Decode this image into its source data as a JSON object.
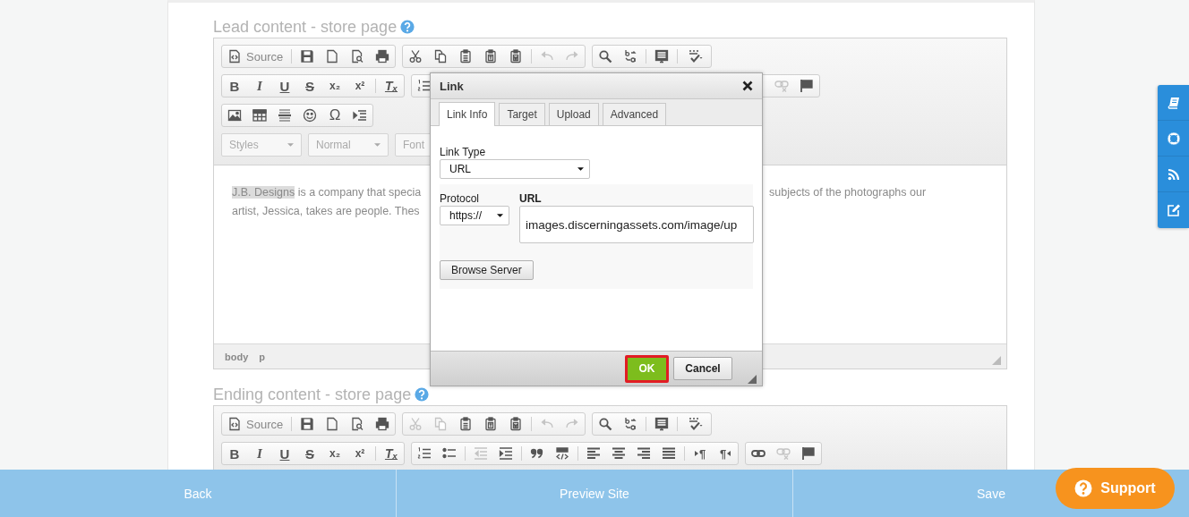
{
  "sections": [
    {
      "title": "Lead content - store page",
      "toolbar": [
        [
          [
            [
              {
                "kind": "source",
                "label": "Source",
                "disabled": false
              }
            ],
            [
              {
                "kind": "save",
                "disabled": false
              },
              {
                "kind": "newpage",
                "disabled": false
              },
              {
                "kind": "preview",
                "disabled": false
              },
              {
                "kind": "print",
                "disabled": false
              }
            ]
          ],
          [
            [
              {
                "kind": "cut",
                "disabled": false
              },
              {
                "kind": "copy",
                "disabled": false
              },
              {
                "kind": "paste",
                "disabled": false
              },
              {
                "kind": "pastetext",
                "disabled": false
              },
              {
                "kind": "pasteword",
                "disabled": false
              }
            ],
            [
              {
                "kind": "undo",
                "disabled": true
              },
              {
                "kind": "redo",
                "disabled": true
              }
            ]
          ],
          [
            [
              {
                "kind": "find",
                "disabled": false
              },
              {
                "kind": "replace",
                "disabled": false
              }
            ],
            [
              {
                "kind": "selectall",
                "disabled": false
              }
            ],
            [
              {
                "kind": "spellcheck",
                "disabled": false
              }
            ]
          ]
        ],
        [
          [
            [
              {
                "kind": "bold",
                "glyph": "B",
                "disabled": false
              },
              {
                "kind": "italic",
                "glyph": "I",
                "disabled": false
              },
              {
                "kind": "underline",
                "glyph": "U",
                "disabled": false
              },
              {
                "kind": "strike",
                "glyph": "S",
                "disabled": false
              },
              {
                "kind": "subscript",
                "glyph": "x₂",
                "disabled": false
              },
              {
                "kind": "superscript",
                "glyph": "x²",
                "disabled": false
              }
            ],
            [
              {
                "kind": "removeformat",
                "glyph": "Tₓ",
                "disabled": false
              }
            ]
          ],
          [
            [
              {
                "kind": "numlist",
                "disabled": false
              }
            ]
          ],
          [
            [
              {
                "kind": "unlink",
                "disabled": true
              },
              {
                "kind": "anchor",
                "disabled": false
              }
            ]
          ]
        ],
        [
          [
            [
              {
                "kind": "image",
                "disabled": false
              },
              {
                "kind": "table",
                "disabled": false
              },
              {
                "kind": "hr",
                "disabled": false
              },
              {
                "kind": "smiley",
                "disabled": false
              },
              {
                "kind": "specialchar",
                "glyph": "Ω",
                "disabled": false
              },
              {
                "kind": "pagebreak",
                "disabled": false
              }
            ]
          ]
        ],
        [
          [
            [
              {
                "kind": "combo",
                "label": "Styles",
                "disabled": true
              }
            ]
          ],
          [
            [
              {
                "kind": "combo",
                "label": "Normal",
                "disabled": true
              }
            ]
          ],
          [
            [
              {
                "kind": "combo",
                "label": "Font",
                "disabled": true
              }
            ]
          ]
        ]
      ],
      "content": {
        "line_1": [
          {
            "text": "J.B. Designs",
            "selected": true
          },
          {
            "text": " is a company that specia",
            "selected": false
          }
        ],
        "line_1_right": "subjects of the photographs our",
        "line_2": "artist, Jessica, takes are people. Thes"
      },
      "path": [
        "body",
        "p"
      ]
    },
    {
      "title": "Ending content - store page",
      "toolbar": [
        [
          [
            [
              {
                "kind": "source",
                "label": "Source",
                "disabled": false
              }
            ],
            [
              {
                "kind": "save",
                "disabled": false
              },
              {
                "kind": "newpage",
                "disabled": false
              },
              {
                "kind": "preview",
                "disabled": false
              },
              {
                "kind": "print",
                "disabled": false
              }
            ]
          ],
          [
            [
              {
                "kind": "cut",
                "disabled": true
              },
              {
                "kind": "copy",
                "disabled": true
              },
              {
                "kind": "paste",
                "disabled": false
              },
              {
                "kind": "pastetext",
                "disabled": false
              },
              {
                "kind": "pasteword",
                "disabled": false
              }
            ],
            [
              {
                "kind": "undo",
                "disabled": true
              },
              {
                "kind": "redo",
                "disabled": true
              }
            ]
          ],
          [
            [
              {
                "kind": "find",
                "disabled": false
              },
              {
                "kind": "replace",
                "disabled": false
              }
            ],
            [
              {
                "kind": "selectall",
                "disabled": false
              }
            ],
            [
              {
                "kind": "spellcheck",
                "disabled": false
              }
            ]
          ]
        ],
        [
          [
            [
              {
                "kind": "bold",
                "glyph": "B",
                "disabled": false
              },
              {
                "kind": "italic",
                "glyph": "I",
                "disabled": false
              },
              {
                "kind": "underline",
                "glyph": "U",
                "disabled": false
              },
              {
                "kind": "strike",
                "glyph": "S",
                "disabled": false
              },
              {
                "kind": "subscript",
                "glyph": "x₂",
                "disabled": false
              },
              {
                "kind": "superscript",
                "glyph": "x²",
                "disabled": false
              }
            ],
            [
              {
                "kind": "removeformat",
                "glyph": "Tₓ",
                "disabled": false
              }
            ]
          ],
          [
            [
              {
                "kind": "numlist",
                "disabled": false
              },
              {
                "kind": "bullist",
                "disabled": false
              }
            ],
            [
              {
                "kind": "outdent",
                "disabled": true
              },
              {
                "kind": "indent",
                "disabled": false
              }
            ],
            [
              {
                "kind": "blockquote",
                "disabled": false
              },
              {
                "kind": "div",
                "disabled": false
              }
            ],
            [
              {
                "kind": "alignleft",
                "disabled": false
              },
              {
                "kind": "aligncenter",
                "disabled": false
              },
              {
                "kind": "alignright",
                "disabled": false
              },
              {
                "kind": "justify",
                "disabled": false
              }
            ],
            [
              {
                "kind": "ltr",
                "glyph": "¶",
                "disabled": false
              },
              {
                "kind": "rtl",
                "glyph": "¶",
                "disabled": false
              }
            ]
          ],
          [
            [
              {
                "kind": "link",
                "disabled": false
              },
              {
                "kind": "unlink",
                "disabled": true
              },
              {
                "kind": "anchor",
                "disabled": false
              }
            ]
          ]
        ]
      ]
    }
  ],
  "dialog": {
    "title": "Link",
    "tabs": [
      {
        "label": "Link Info",
        "selected": true
      },
      {
        "label": "Target",
        "selected": false
      },
      {
        "label": "Upload",
        "selected": false
      },
      {
        "label": "Advanced",
        "selected": false
      }
    ],
    "link_type": {
      "label": "Link Type",
      "value": "URL"
    },
    "protocol": {
      "label": "Protocol",
      "value": "https://"
    },
    "url": {
      "label": "URL",
      "value": "images.discerningassets.com/image/up"
    },
    "browse_button": "Browse Server",
    "buttons": [
      {
        "label": "OK",
        "kind": "primary",
        "highlighted": true
      },
      {
        "label": "Cancel",
        "kind": "secondary",
        "highlighted": false
      }
    ]
  },
  "footer": {
    "buttons": [
      "Back",
      "Preview Site",
      "Save"
    ]
  },
  "support": {
    "label": "Support"
  }
}
